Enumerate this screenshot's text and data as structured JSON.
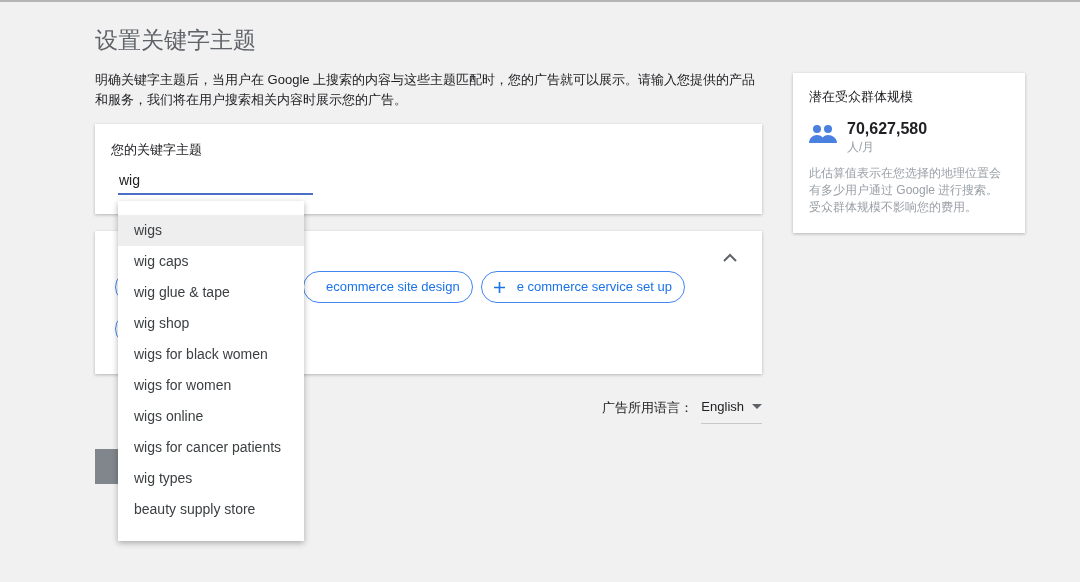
{
  "title": "设置关键字主题",
  "description": "明确关键字主题后，当用户在 Google 上搜索的内容与这些主题匹配时，您的广告就可以展示。请输入您提供的产品和服务，我们将在用户搜索相关内容时展示您的广告。",
  "keyword_card": {
    "label": "您的关键字主题",
    "value": "wig"
  },
  "suggestions_card": {
    "expanded": true,
    "chips": [
      {
        "kind": "hidden"
      },
      {
        "kind": "label",
        "label": "ecommerce site design"
      },
      {
        "kind": "plus",
        "label": "e commerce service set up"
      },
      {
        "kind": "hidden"
      }
    ]
  },
  "language": {
    "label": "广告所用语言：",
    "value": "English"
  },
  "audience": {
    "title": "潜在受众群体规模",
    "count": "70,627,580",
    "unit": "人/月",
    "note": "此估算值表示在您选择的地理位置会有多少用户通过 Google 进行搜索。受众群体规模不影响您的费用。"
  },
  "dropdown": [
    {
      "label": "wigs",
      "selected": true
    },
    {
      "label": "wig caps",
      "selected": false
    },
    {
      "label": "wig glue & tape",
      "selected": false
    },
    {
      "label": "wig shop",
      "selected": false
    },
    {
      "label": "wigs for black women",
      "selected": false
    },
    {
      "label": "wigs for women",
      "selected": false
    },
    {
      "label": "wigs online",
      "selected": false
    },
    {
      "label": "wigs for cancer patients",
      "selected": false
    },
    {
      "label": "wig types",
      "selected": false
    },
    {
      "label": "beauty supply store",
      "selected": false
    }
  ]
}
